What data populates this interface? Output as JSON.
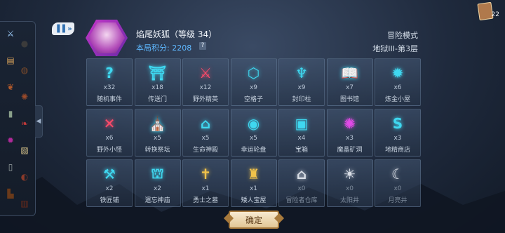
{
  "header": {
    "hero_name": "焰尾妖狐（等级 34）",
    "score_text": "本局积分:  2208",
    "help_label": "?",
    "mode": "冒险模式",
    "stage": "地狱III-第3层"
  },
  "deck": {
    "count": "22"
  },
  "speed_button": {
    "label": "▐▐ »"
  },
  "sidebar": {
    "tab_glyph": "◀"
  },
  "confirm_label": "确定",
  "colors": {
    "accent_cyan": "#3fd8f0",
    "score_blue": "#5fb8ff",
    "gold": "#e2c796"
  },
  "grid": [
    {
      "icon": "question-icon",
      "glyph": "?",
      "count": "x32",
      "name": "随机事件",
      "color": "#3fd8f0"
    },
    {
      "icon": "portal-icon",
      "glyph": "⛩",
      "count": "x18",
      "name": "传送门",
      "color": "#3fd8f0"
    },
    {
      "icon": "crossed-swords-icon",
      "glyph": "⚔",
      "count": "x12",
      "name": "野外精英",
      "color": "#ff4a6a"
    },
    {
      "icon": "hexagon-icon",
      "glyph": "⬡",
      "count": "x9",
      "name": "空格子",
      "color": "#3fd8f0"
    },
    {
      "icon": "seal-pillar-icon",
      "glyph": "♆",
      "count": "x9",
      "name": "封印柱",
      "color": "#3fd8f0"
    },
    {
      "icon": "book-icon",
      "glyph": "📖",
      "count": "x7",
      "name": "图书馆",
      "color": "#3fd8f0"
    },
    {
      "icon": "alchemy-icon",
      "glyph": "✹",
      "count": "x6",
      "name": "炼金小屋",
      "color": "#3fd8f0"
    },
    {
      "icon": "sword-icon",
      "glyph": "✕",
      "count": "x6",
      "name": "野外小怪",
      "color": "#ff4a6a"
    },
    {
      "icon": "altar-icon",
      "glyph": "⛪",
      "count": "x5",
      "name": "转换祭坛",
      "color": "#3fd8f0"
    },
    {
      "icon": "temple-icon",
      "glyph": "⌂",
      "count": "x5",
      "name": "生命神殿",
      "color": "#3fd8f0"
    },
    {
      "icon": "eye-wheel-icon",
      "glyph": "◉",
      "count": "x5",
      "name": "幸运轮盘",
      "color": "#3fd8f0"
    },
    {
      "icon": "chest-icon",
      "glyph": "▣",
      "count": "x4",
      "name": "宝箱",
      "color": "#3fd8f0"
    },
    {
      "icon": "demon-cave-icon",
      "glyph": "✺",
      "count": "x3",
      "name": "魔晶矿洞",
      "color": "#e24ae8"
    },
    {
      "icon": "shop-icon",
      "glyph": "S",
      "count": "x3",
      "name": "地精商店",
      "color": "#3fd8f0"
    },
    {
      "icon": "anvil-icon",
      "glyph": "⚒",
      "count": "x2",
      "name": "铁匠铺",
      "color": "#3fd8f0"
    },
    {
      "icon": "shrine-icon",
      "glyph": "⛫",
      "count": "x2",
      "name": "遗忘神庙",
      "color": "#3fd8f0"
    },
    {
      "icon": "tomb-icon",
      "glyph": "✝",
      "count": "x1",
      "name": "勇士之墓",
      "color": "#f0c24a"
    },
    {
      "icon": "dwarf-treasure-icon",
      "glyph": "♜",
      "count": "x1",
      "name": "矮人宝屋",
      "color": "#f0c24a"
    },
    {
      "icon": "warehouse-icon",
      "glyph": "⌂",
      "count": "x0",
      "name": "冒险者仓库",
      "color": "#d9dee6"
    },
    {
      "icon": "sun-well-icon",
      "glyph": "☀",
      "count": "x0",
      "name": "太阳井",
      "color": "#d9dee6"
    },
    {
      "icon": "moon-well-icon",
      "glyph": "☾",
      "count": "x0",
      "name": "月亮井",
      "color": "#d9dee6"
    }
  ],
  "inventory": [
    {
      "icon": "sword-icon",
      "glyph": "⚔",
      "color": "#9fd0ff"
    },
    {
      "icon": "bomb-icon",
      "glyph": "●",
      "color": "#3b3b3b"
    },
    {
      "icon": "scroll-icon",
      "glyph": "▤",
      "color": "#d9a25a"
    },
    {
      "icon": "drum-icon",
      "glyph": "◍",
      "color": "#7a4a2a"
    },
    {
      "icon": "leaf-icon",
      "glyph": "❦",
      "color": "#b35a2a"
    },
    {
      "icon": "gear-icon",
      "glyph": "✺",
      "color": "#9a4a2a"
    },
    {
      "icon": "stone-icon",
      "glyph": "▮",
      "color": "#8aa08a"
    },
    {
      "icon": "horn-icon",
      "glyph": "❧",
      "color": "#c23a3a"
    },
    {
      "icon": "fire-icon",
      "glyph": "✹",
      "color": "#b02a9a"
    },
    {
      "icon": "map-icon",
      "glyph": "▧",
      "color": "#d8c48a"
    },
    {
      "icon": "tablet-icon",
      "glyph": "▯",
      "color": "#9aa4a4"
    },
    {
      "icon": "pot-icon",
      "glyph": "◐",
      "color": "#8a3a2a"
    },
    {
      "icon": "boot-icon",
      "glyph": "▙",
      "color": "#6a3a1a"
    },
    {
      "icon": "book-icon",
      "glyph": "▥",
      "color": "#6a2a1a"
    }
  ]
}
